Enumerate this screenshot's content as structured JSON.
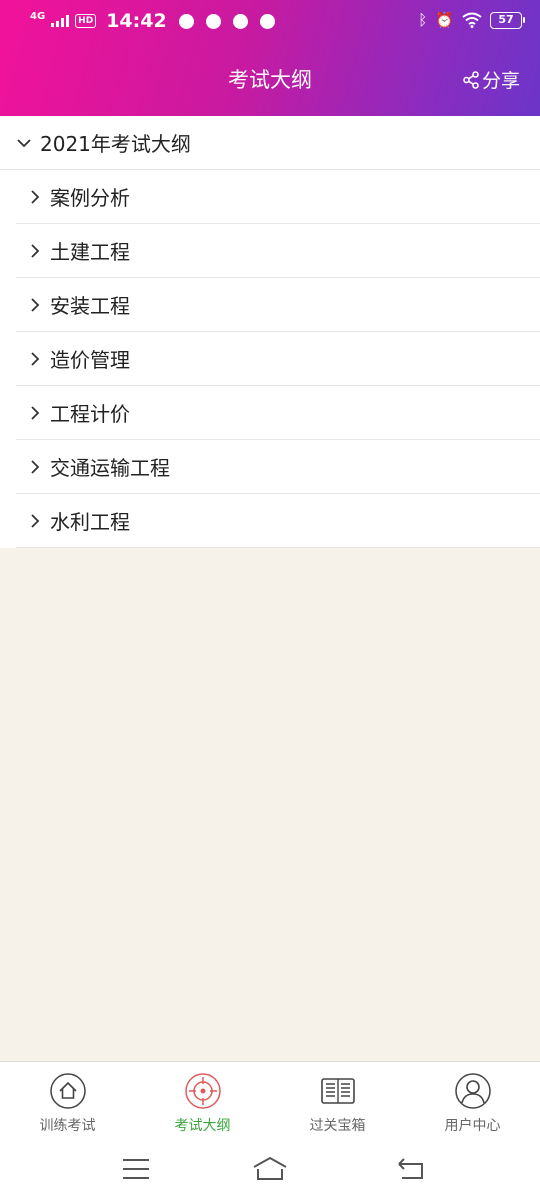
{
  "status_bar": {
    "network": "4G",
    "hd": "HD",
    "time": "14:42",
    "battery": "57"
  },
  "header": {
    "title": "考试大纲",
    "share_label": "分享"
  },
  "outline": {
    "root_label": "2021年考试大纲",
    "items": [
      {
        "label": "案例分析"
      },
      {
        "label": "土建工程"
      },
      {
        "label": "安装工程"
      },
      {
        "label": "造价管理"
      },
      {
        "label": "工程计价"
      },
      {
        "label": "交通运输工程"
      },
      {
        "label": "水利工程"
      }
    ]
  },
  "tabs": [
    {
      "label": "训练考试",
      "icon": "home-icon"
    },
    {
      "label": "考试大纲",
      "icon": "target-icon",
      "active": true
    },
    {
      "label": "过关宝箱",
      "icon": "newspaper-icon"
    },
    {
      "label": "用户中心",
      "icon": "user-icon"
    }
  ],
  "colors": {
    "header_start": "#f2129a",
    "header_end": "#6b35c8",
    "active_tab": "#3aa53a",
    "target_icon": "#e05a5a",
    "background": "#f6f2ea"
  }
}
